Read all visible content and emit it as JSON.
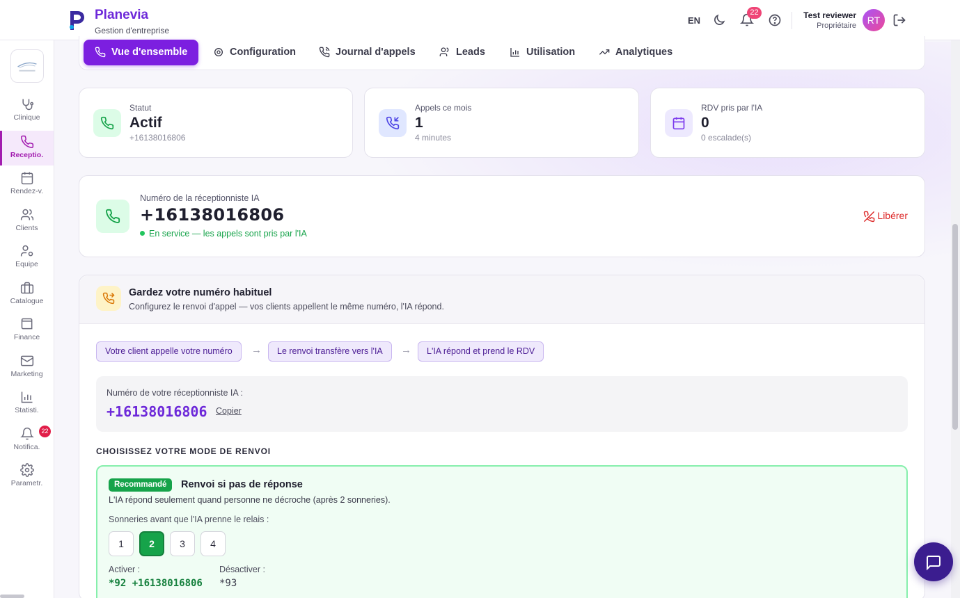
{
  "app": {
    "name": "Planevia",
    "subtitle": "Gestion d'entreprise"
  },
  "header": {
    "lang": "EN",
    "notifications_count": "22",
    "user_name": "Test reviewer",
    "user_role": "Propriétaire",
    "avatar_initials": "RT"
  },
  "sidebar": {
    "items": [
      {
        "label": "Clinique",
        "icon": "stethoscope-icon"
      },
      {
        "label": "Receptio.",
        "icon": "phone-icon",
        "active": true
      },
      {
        "label": "Rendez-v.",
        "icon": "calendar-icon"
      },
      {
        "label": "Clients",
        "icon": "users-icon"
      },
      {
        "label": "Equipe",
        "icon": "user-cog-icon"
      },
      {
        "label": "Catalogue",
        "icon": "briefcase-icon"
      },
      {
        "label": "Finance",
        "icon": "wallet-icon"
      },
      {
        "label": "Marketing",
        "icon": "mail-icon"
      },
      {
        "label": "Statisti.",
        "icon": "bar-chart-icon"
      },
      {
        "label": "Notifica.",
        "icon": "bell-icon",
        "badge": "22"
      },
      {
        "label": "Parametr.",
        "icon": "gear-icon"
      }
    ]
  },
  "tabs": [
    {
      "label": "Vue d'ensemble",
      "icon": "phone-icon",
      "active": true
    },
    {
      "label": "Configuration",
      "icon": "gear-icon"
    },
    {
      "label": "Journal d'appels",
      "icon": "phone-call-icon"
    },
    {
      "label": "Leads",
      "icon": "users-icon"
    },
    {
      "label": "Utilisation",
      "icon": "bar-chart-icon"
    },
    {
      "label": "Analytiques",
      "icon": "trending-up-icon"
    }
  ],
  "stats": [
    {
      "label": "Statut",
      "value": "Actif",
      "sub": "+16138016806",
      "icon": "phone-icon",
      "color": "#16a34a"
    },
    {
      "label": "Appels ce mois",
      "value": "1",
      "sub": "4 minutes",
      "icon": "phone-incoming-icon",
      "color": "#4f46e5"
    },
    {
      "label": "RDV pris par l'IA",
      "value": "0",
      "sub": "0 escalade(s)",
      "icon": "calendar-icon",
      "color": "#7c3aed"
    }
  ],
  "number_card": {
    "label": "Numéro de la réceptionniste IA",
    "number": "+16138016806",
    "status": "En service — les appels sont pris par l'IA",
    "release": "Libérer"
  },
  "forwarding": {
    "title": "Gardez votre numéro habituel",
    "subtitle": "Configurez le renvoi d'appel — vos clients appellent le même numéro, l'IA répond.",
    "flow": [
      "Votre client appelle votre numéro",
      "Le renvoi transfère vers l'IA",
      "L'IA répond et prend le RDV"
    ],
    "arrow": "→",
    "number_label": "Numéro de votre réceptionniste IA :",
    "number": "+16138016806",
    "copy": "Copier",
    "mode_title": "CHOISISSEZ VOTRE MODE DE RENVOI",
    "option": {
      "badge": "Recommandé",
      "title": "Renvoi si pas de réponse",
      "desc": "L'IA répond seulement quand personne ne décroche (après 2 sonneries).",
      "rings_label": "Sonneries avant que l'IA prenne le relais :",
      "rings": [
        "1",
        "2",
        "3",
        "4"
      ],
      "selected_ring": "2",
      "activate_label": "Activer :",
      "activate_code": "*92 +16138016806",
      "deactivate_label": "Désactiver :",
      "deactivate_code": "*93"
    }
  },
  "colors": {
    "accent": "#7c1fe0",
    "success": "#16a34a",
    "danger": "#dc2626"
  }
}
